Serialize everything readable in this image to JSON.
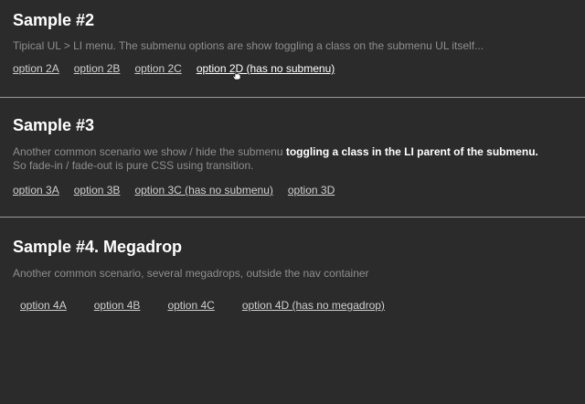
{
  "sample2": {
    "title": "Sample #2",
    "description": "Tipical UL > LI menu. The submenu options are show toggling a class on the submenu UL itself...",
    "options": [
      "option 2A",
      "option 2B",
      "option 2C",
      "option 2D (has no submenu)"
    ]
  },
  "sample3": {
    "title": "Sample #3",
    "description_prefix": "Another common scenario we show / hide the submenu ",
    "description_strong": "toggling a class in the LI parent of the submenu.",
    "description_line2": "So fade-in / fade-out is pure CSS using transition.",
    "options": [
      "option 3A",
      "option 3B",
      "option 3C (has no submenu)",
      "option 3D"
    ]
  },
  "sample4": {
    "title": "Sample #4. Megadrop",
    "description": "Another common scenario, several megadrops, outside the nav container",
    "options": [
      "option 4A",
      "option 4B",
      "option 4C",
      "option 4D (has no megadrop)"
    ]
  },
  "cursor": {
    "icon": "hand-pointer-icon"
  }
}
